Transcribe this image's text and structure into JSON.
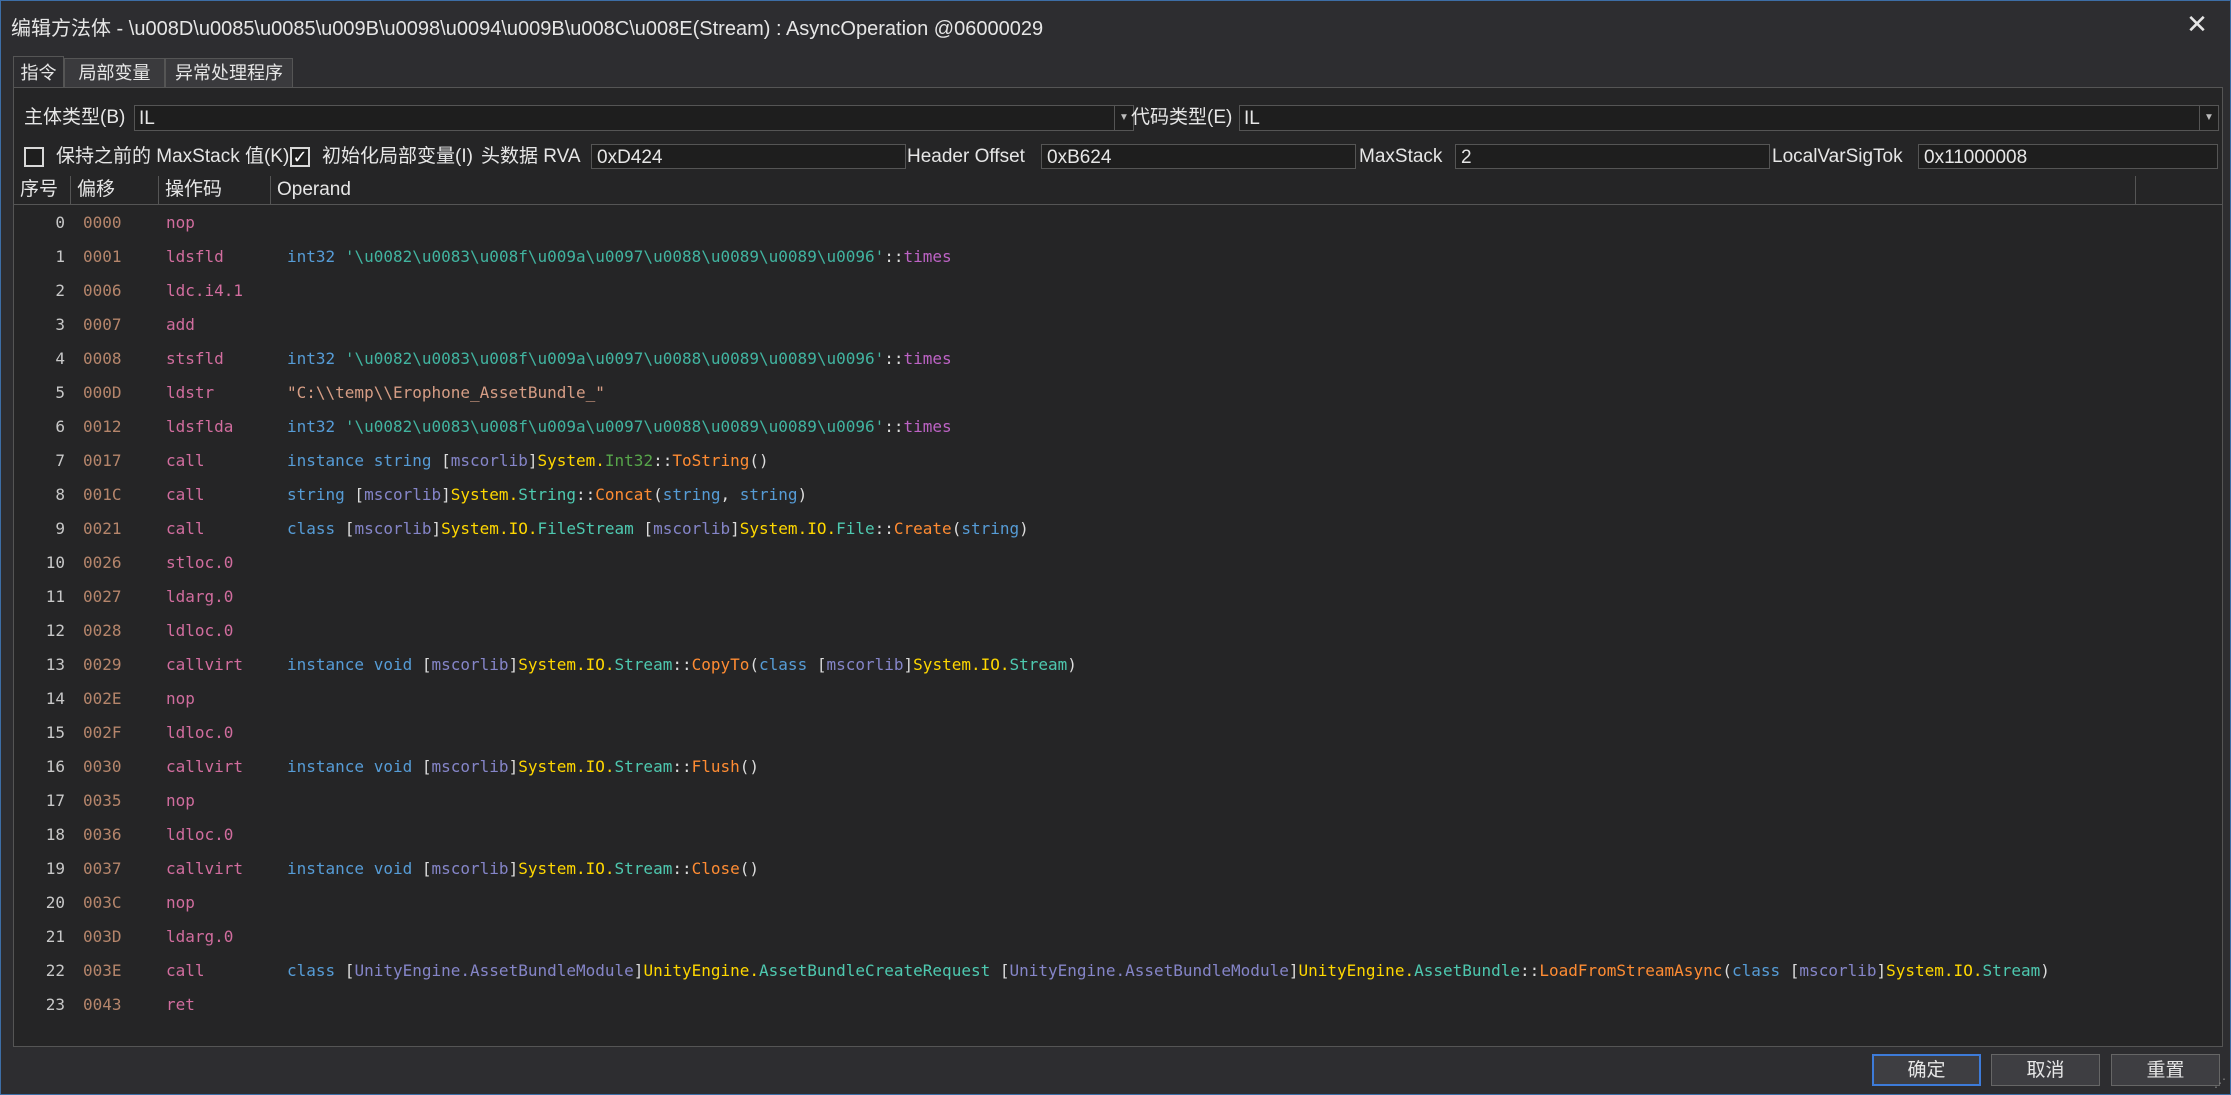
{
  "window": {
    "title": "编辑方法体 - \\u008D\\u0085\\u0085\\u009B\\u0098\\u0094\\u009B\\u008C\\u008E(Stream) : AsyncOperation @06000029",
    "close_glyph": "✕"
  },
  "tabs": [
    "指令",
    "局部变量",
    "异常处理程序"
  ],
  "settings": {
    "body_type_label": "主体类型(B)",
    "body_type_value": "IL",
    "code_type_label": "代码类型(E)",
    "code_type_value": "IL",
    "keep_maxstack_label": "保持之前的 MaxStack 值(K)",
    "keep_maxstack_checked": false,
    "init_locals_label": "初始化局部变量(I)",
    "init_locals_checked": true,
    "header_rva_label": "头数据 RVA",
    "header_rva_value": "0xD424",
    "header_offset_label": "Header Offset",
    "header_offset_value": "0xB624",
    "maxstack_label": "MaxStack",
    "maxstack_value": "2",
    "localvarsigtok_label": "LocalVarSigTok",
    "localvarsigtok_value": "0x11000008"
  },
  "columns": [
    "序号",
    "偏移",
    "操作码",
    "Operand"
  ],
  "instructions": [
    {
      "index": "0",
      "offset": "0000",
      "opcode": "nop",
      "operand": []
    },
    {
      "index": "1",
      "offset": "0001",
      "opcode": "ldsfld",
      "operand": [
        [
          "kw",
          "int32"
        ],
        [
          "punc",
          " "
        ],
        [
          "quoted",
          "'\\u0082\\u0083\\u008f\\u009a\\u0097\\u0088\\u0089\\u0089\\u0096'"
        ],
        [
          "punc",
          "::"
        ],
        [
          "fld",
          "times"
        ]
      ]
    },
    {
      "index": "2",
      "offset": "0006",
      "opcode": "ldc.i4.1",
      "operand": []
    },
    {
      "index": "3",
      "offset": "0007",
      "opcode": "add",
      "operand": []
    },
    {
      "index": "4",
      "offset": "0008",
      "opcode": "stsfld",
      "operand": [
        [
          "kw",
          "int32"
        ],
        [
          "punc",
          " "
        ],
        [
          "quoted",
          "'\\u0082\\u0083\\u008f\\u009a\\u0097\\u0088\\u0089\\u0089\\u0096'"
        ],
        [
          "punc",
          "::"
        ],
        [
          "fld",
          "times"
        ]
      ]
    },
    {
      "index": "5",
      "offset": "000D",
      "opcode": "ldstr",
      "operand": [
        [
          "str",
          "\"C:\\\\temp\\\\Erophone_AssetBundle_\""
        ]
      ]
    },
    {
      "index": "6",
      "offset": "0012",
      "opcode": "ldsflda",
      "operand": [
        [
          "kw",
          "int32"
        ],
        [
          "punc",
          " "
        ],
        [
          "quoted",
          "'\\u0082\\u0083\\u008f\\u009a\\u0097\\u0088\\u0089\\u0089\\u0096'"
        ],
        [
          "punc",
          "::"
        ],
        [
          "fld",
          "times"
        ]
      ]
    },
    {
      "index": "7",
      "offset": "0017",
      "opcode": "call",
      "operand": [
        [
          "kw",
          "instance string"
        ],
        [
          "punc",
          " ["
        ],
        [
          "asm",
          "mscorlib"
        ],
        [
          "punc",
          "]"
        ],
        [
          "ns",
          "System."
        ],
        [
          "vtyp",
          "Int32"
        ],
        [
          "punc",
          "::"
        ],
        [
          "meth",
          "ToString"
        ],
        [
          "punc",
          "()"
        ]
      ]
    },
    {
      "index": "8",
      "offset": "001C",
      "opcode": "call",
      "operand": [
        [
          "kw",
          "string"
        ],
        [
          "punc",
          " ["
        ],
        [
          "asm",
          "mscorlib"
        ],
        [
          "punc",
          "]"
        ],
        [
          "ns",
          "System."
        ],
        [
          "typ",
          "String"
        ],
        [
          "punc",
          "::"
        ],
        [
          "meth",
          "Concat"
        ],
        [
          "punc",
          "("
        ],
        [
          "kw",
          "string"
        ],
        [
          "punc",
          ", "
        ],
        [
          "kw",
          "string"
        ],
        [
          "punc",
          ")"
        ]
      ]
    },
    {
      "index": "9",
      "offset": "0021",
      "opcode": "call",
      "operand": [
        [
          "kw",
          "class"
        ],
        [
          "punc",
          " ["
        ],
        [
          "asm",
          "mscorlib"
        ],
        [
          "punc",
          "]"
        ],
        [
          "ns",
          "System.IO."
        ],
        [
          "typ",
          "FileStream"
        ],
        [
          "punc",
          " ["
        ],
        [
          "asm",
          "mscorlib"
        ],
        [
          "punc",
          "]"
        ],
        [
          "ns",
          "System.IO."
        ],
        [
          "typ",
          "File"
        ],
        [
          "punc",
          "::"
        ],
        [
          "meth",
          "Create"
        ],
        [
          "punc",
          "("
        ],
        [
          "kw",
          "string"
        ],
        [
          "punc",
          ")"
        ]
      ]
    },
    {
      "index": "10",
      "offset": "0026",
      "opcode": "stloc.0",
      "operand": []
    },
    {
      "index": "11",
      "offset": "0027",
      "opcode": "ldarg.0",
      "operand": []
    },
    {
      "index": "12",
      "offset": "0028",
      "opcode": "ldloc.0",
      "operand": []
    },
    {
      "index": "13",
      "offset": "0029",
      "opcode": "callvirt",
      "operand": [
        [
          "kw",
          "instance void"
        ],
        [
          "punc",
          " ["
        ],
        [
          "asm",
          "mscorlib"
        ],
        [
          "punc",
          "]"
        ],
        [
          "ns",
          "System.IO."
        ],
        [
          "typ",
          "Stream"
        ],
        [
          "punc",
          "::"
        ],
        [
          "meth",
          "CopyTo"
        ],
        [
          "punc",
          "("
        ],
        [
          "kw",
          "class"
        ],
        [
          "punc",
          " ["
        ],
        [
          "asm",
          "mscorlib"
        ],
        [
          "punc",
          "]"
        ],
        [
          "ns",
          "System.IO."
        ],
        [
          "typ",
          "Stream"
        ],
        [
          "punc",
          ")"
        ]
      ]
    },
    {
      "index": "14",
      "offset": "002E",
      "opcode": "nop",
      "operand": []
    },
    {
      "index": "15",
      "offset": "002F",
      "opcode": "ldloc.0",
      "operand": []
    },
    {
      "index": "16",
      "offset": "0030",
      "opcode": "callvirt",
      "operand": [
        [
          "kw",
          "instance void"
        ],
        [
          "punc",
          " ["
        ],
        [
          "asm",
          "mscorlib"
        ],
        [
          "punc",
          "]"
        ],
        [
          "ns",
          "System.IO."
        ],
        [
          "typ",
          "Stream"
        ],
        [
          "punc",
          "::"
        ],
        [
          "meth",
          "Flush"
        ],
        [
          "punc",
          "()"
        ]
      ]
    },
    {
      "index": "17",
      "offset": "0035",
      "opcode": "nop",
      "operand": []
    },
    {
      "index": "18",
      "offset": "0036",
      "opcode": "ldloc.0",
      "operand": []
    },
    {
      "index": "19",
      "offset": "0037",
      "opcode": "callvirt",
      "operand": [
        [
          "kw",
          "instance void"
        ],
        [
          "punc",
          " ["
        ],
        [
          "asm",
          "mscorlib"
        ],
        [
          "punc",
          "]"
        ],
        [
          "ns",
          "System.IO."
        ],
        [
          "typ",
          "Stream"
        ],
        [
          "punc",
          "::"
        ],
        [
          "meth",
          "Close"
        ],
        [
          "punc",
          "()"
        ]
      ]
    },
    {
      "index": "20",
      "offset": "003C",
      "opcode": "nop",
      "operand": []
    },
    {
      "index": "21",
      "offset": "003D",
      "opcode": "ldarg.0",
      "operand": []
    },
    {
      "index": "22",
      "offset": "003E",
      "opcode": "call",
      "operand": [
        [
          "kw",
          "class"
        ],
        [
          "punc",
          " ["
        ],
        [
          "asm",
          "UnityEngine.AssetBundleModule"
        ],
        [
          "punc",
          "]"
        ],
        [
          "ns",
          "UnityEngine."
        ],
        [
          "typ",
          "AssetBundleCreateRequest"
        ],
        [
          "punc",
          " ["
        ],
        [
          "asm",
          "UnityEngine.AssetBundleModule"
        ],
        [
          "punc",
          "]"
        ],
        [
          "ns",
          "UnityEngine."
        ],
        [
          "typ",
          "AssetBundle"
        ],
        [
          "punc",
          "::"
        ],
        [
          "meth",
          "LoadFromStreamAsync"
        ],
        [
          "punc",
          "("
        ],
        [
          "kw",
          "class"
        ],
        [
          "punc",
          " ["
        ],
        [
          "asm",
          "mscorlib"
        ],
        [
          "punc",
          "]"
        ],
        [
          "ns",
          "System.IO."
        ],
        [
          "typ",
          "Stream"
        ],
        [
          "punc",
          ")"
        ]
      ]
    },
    {
      "index": "23",
      "offset": "0043",
      "opcode": "ret",
      "operand": []
    }
  ],
  "buttons": {
    "ok": "确定",
    "cancel": "取消",
    "reset": "重置"
  }
}
